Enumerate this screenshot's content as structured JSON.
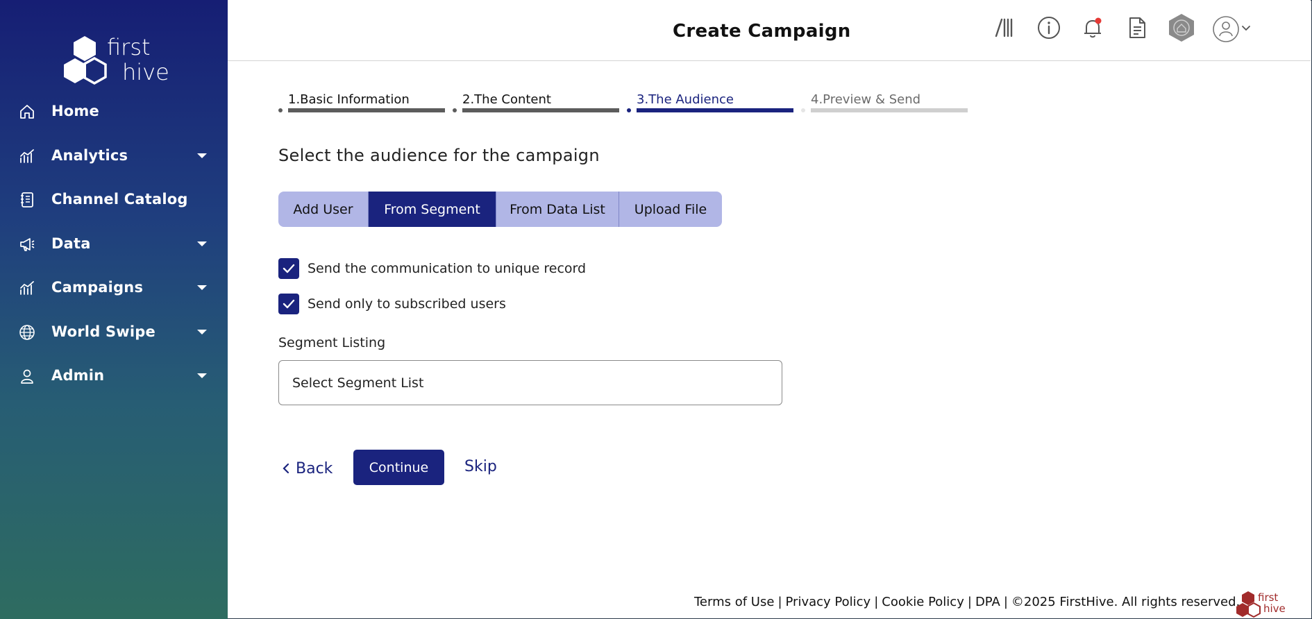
{
  "app": {
    "brand_line1": "first",
    "brand_line2": "hive",
    "page_title": "Create Campaign"
  },
  "sidebar": {
    "items": [
      {
        "label": "Home",
        "icon": "home-icon",
        "has_dropdown": false
      },
      {
        "label": "Analytics",
        "icon": "analytics-icon",
        "has_dropdown": true
      },
      {
        "label": "Channel Catalog",
        "icon": "catalog-icon",
        "has_dropdown": false
      },
      {
        "label": "Data",
        "icon": "megaphone-icon",
        "has_dropdown": true
      },
      {
        "label": "Campaigns",
        "icon": "campaigns-icon",
        "has_dropdown": true
      },
      {
        "label": "World Swipe",
        "icon": "globe-icon",
        "has_dropdown": true
      },
      {
        "label": "Admin",
        "icon": "user-icon",
        "has_dropdown": true
      }
    ]
  },
  "header": {
    "icons": [
      "library-icon",
      "info-icon",
      "bell-icon",
      "document-icon",
      "hexagon-home-icon",
      "profile-icon",
      "chevron-down-icon"
    ],
    "notification_dot_color": "#e53935"
  },
  "stepper": {
    "steps": [
      {
        "label": "1.Basic Information",
        "state": "done"
      },
      {
        "label": "2.The Content",
        "state": "done"
      },
      {
        "label": "3.The Audience",
        "state": "active"
      },
      {
        "label": "4.Preview & Send",
        "state": "pending"
      }
    ]
  },
  "main": {
    "section_title": "Select the audience for the campaign",
    "source_tabs": [
      {
        "label": "Add User",
        "active": false
      },
      {
        "label": "From Segment",
        "active": true
      },
      {
        "label": "From Data List",
        "active": false
      },
      {
        "label": "Upload File",
        "active": false
      }
    ],
    "checkboxes": [
      {
        "label": "Send the communication to unique record",
        "checked": true
      },
      {
        "label": "Send only to subscribed users",
        "checked": true
      }
    ],
    "segment_label": "Segment Listing",
    "segment_select_value": "Select Segment List",
    "back_label": "Back",
    "continue_label": "Continue",
    "skip_label": "Skip"
  },
  "footer": {
    "terms": "Terms of Use",
    "privacy": "Privacy Policy",
    "cookie": "Cookie Policy",
    "dpa": "DPA",
    "copyright": "©2025 FirstHive. All rights reserved.",
    "separator": "|",
    "logo_line1": "first",
    "logo_line2": "hive"
  },
  "colors": {
    "accent": "#1a237e",
    "tab_inactive": "#b1b6e6",
    "step_done_bar": "#5c5c5c",
    "step_pending_bar": "#cfcfcf",
    "footer_logo": "#a12b2b"
  }
}
